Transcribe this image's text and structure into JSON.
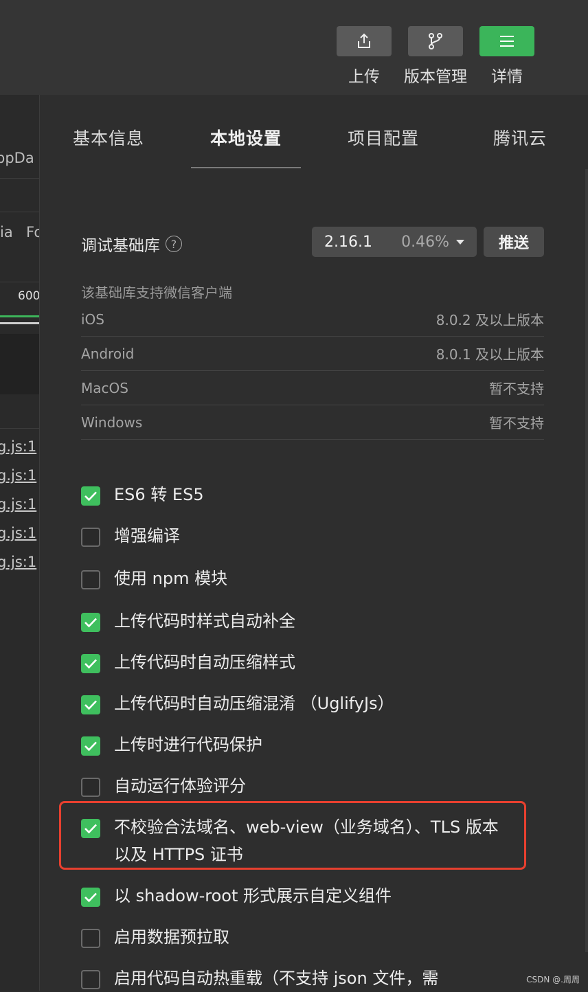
{
  "toolbar": {
    "buttons": [
      {
        "label": "上传",
        "icon": "upload-icon"
      },
      {
        "label": "版本管理",
        "icon": "branch-icon"
      },
      {
        "label": "详情",
        "icon": "menu-icon"
      }
    ],
    "accent": "#3bb55a"
  },
  "left_panel": {
    "fragments": [
      "ppDa",
      "ia",
      "Fo",
      "600"
    ],
    "links": [
      "g.js:1",
      "g.js:1",
      "g.js:1",
      "g.js:1",
      "g.js:1"
    ]
  },
  "tabs": [
    {
      "label": "基本信息",
      "active": false
    },
    {
      "label": "本地设置",
      "active": true
    },
    {
      "label": "项目配置",
      "active": false
    },
    {
      "label": "腾讯云",
      "active": false
    }
  ],
  "debug_lib": {
    "label": "调试基础库",
    "help_icon": "help-icon",
    "version": "2.16.1",
    "percent": "0.46%",
    "push_label": "推送"
  },
  "support": {
    "note": "该基础库支持微信客户端",
    "rows": [
      {
        "platform": "iOS",
        "value": "8.0.2 及以上版本"
      },
      {
        "platform": "Android",
        "value": "8.0.1 及以上版本"
      },
      {
        "platform": "MacOS",
        "value": "暂不支持"
      },
      {
        "platform": "Windows",
        "value": "暂不支持"
      }
    ]
  },
  "options": [
    {
      "label": "ES6 转 ES5",
      "checked": true
    },
    {
      "label": "增强编译",
      "checked": false
    },
    {
      "label": "使用 npm 模块",
      "checked": false
    },
    {
      "label": "上传代码时样式自动补全",
      "checked": true
    },
    {
      "label": "上传代码时自动压缩样式",
      "checked": true
    },
    {
      "label": "上传代码时自动压缩混淆 （UglifyJs）",
      "checked": true
    },
    {
      "label": "上传时进行代码保护",
      "checked": true
    },
    {
      "label": "自动运行体验评分",
      "checked": false
    },
    {
      "label": "不校验合法域名、web-view（业务域名）、TLS 版本以及 HTTPS 证书",
      "checked": true
    },
    {
      "label": "以 shadow-root 形式展示自定义组件",
      "checked": true
    },
    {
      "label": "启用数据预拉取",
      "checked": false
    },
    {
      "label": "启用代码自动热重载（不支持 json 文件，需",
      "checked": false
    }
  ],
  "watermark": "CSDN @.周周"
}
